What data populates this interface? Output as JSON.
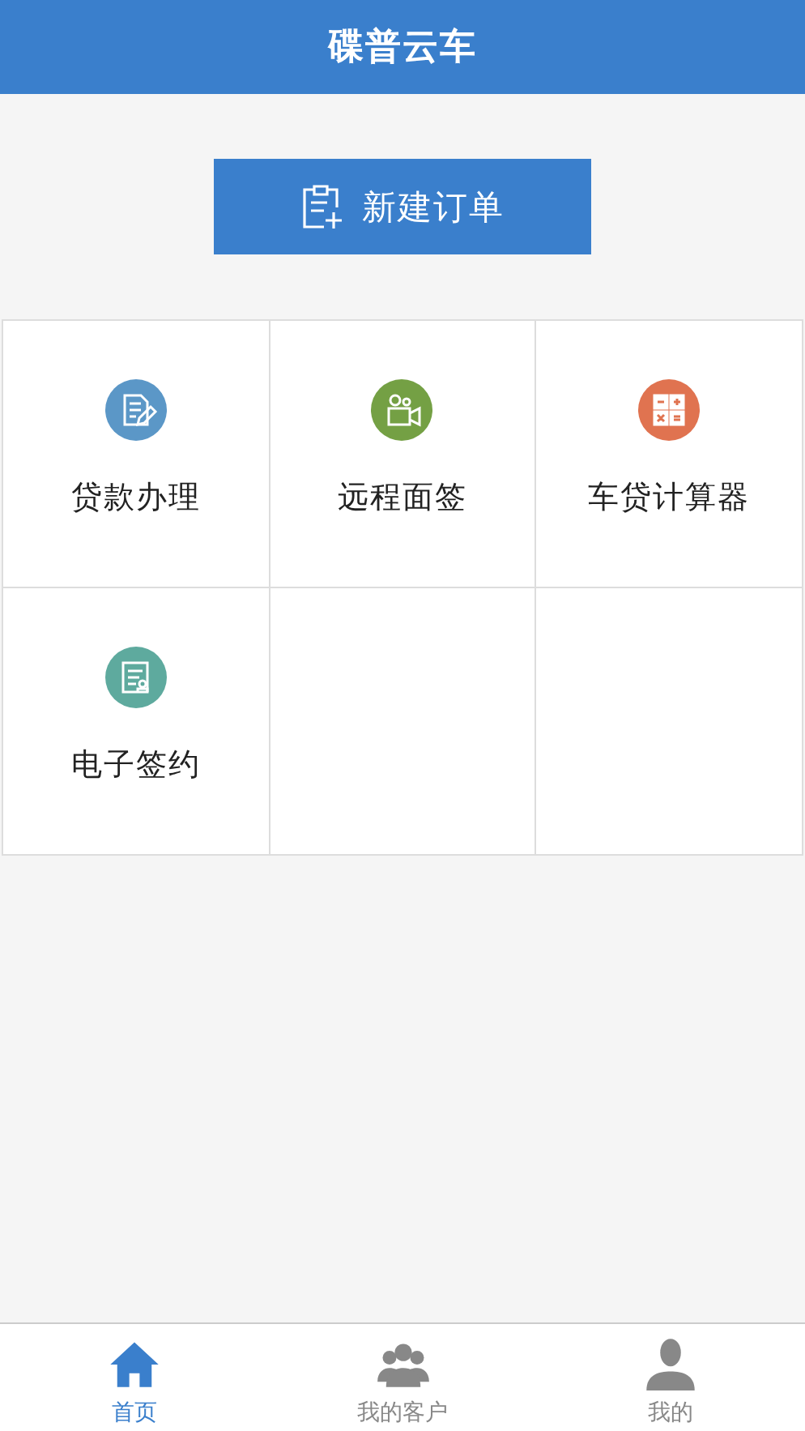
{
  "header": {
    "title": "碟普云车"
  },
  "new_order_button": {
    "label": "新建订单"
  },
  "features": [
    {
      "label": "贷款办理",
      "kind": "loan",
      "color": "#5b97c7"
    },
    {
      "label": "远程面签",
      "kind": "video",
      "color": "#74a044"
    },
    {
      "label": "车贷计算器",
      "kind": "calculator",
      "color": "#e07350"
    },
    {
      "label": "电子签约",
      "kind": "contract",
      "color": "#5eaa9e"
    }
  ],
  "tabs": [
    {
      "label": "首页",
      "kind": "home",
      "selected": true
    },
    {
      "label": "我的客户",
      "kind": "customers",
      "selected": false
    },
    {
      "label": "我的",
      "kind": "profile",
      "selected": false
    }
  ]
}
